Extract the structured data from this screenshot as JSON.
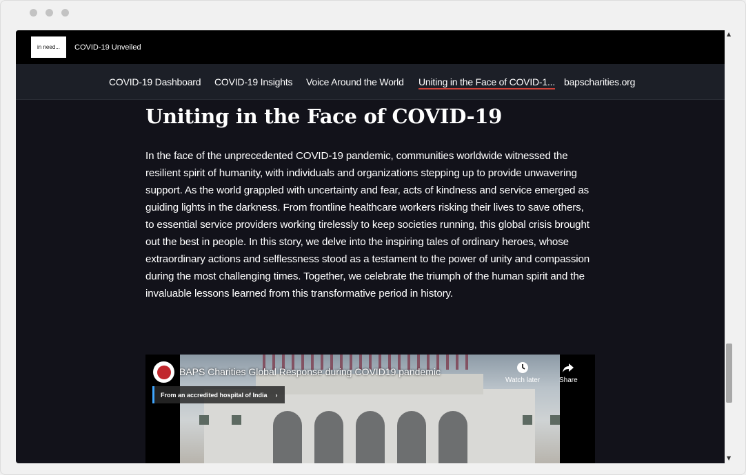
{
  "site": {
    "logo_text": "in need...",
    "title": "COVID-19 Unveiled"
  },
  "nav": {
    "items": [
      {
        "label": "COVID-19 Dashboard"
      },
      {
        "label": "COVID-19 Insights"
      },
      {
        "label": "Voice Around the World"
      },
      {
        "label": "Uniting in the Face of COVID-1..."
      },
      {
        "label": "bapscharities.org"
      }
    ],
    "active_index": 3
  },
  "article": {
    "heading": "Uniting in the Face of COVID-19",
    "body": "In the face of the unprecedented COVID-19 pandemic, communities worldwide witnessed the resilient spirit of humanity, with individuals and organizations stepping up to provide unwavering support. As the world grappled with uncertainty and fear, acts of kindness and service emerged as guiding lights in the darkness. From frontline healthcare workers risking their lives to save others, to essential service providers working tirelessly to keep societies running, this global crisis brought out the best in people. In this story, we delve into the inspiring tales of ordinary heroes, whose extraordinary actions and selflessness stood as a testament to the power of unity and compassion during the most challenging times. Together, we celebrate the triumph of the human spirit and the invaluable lessons learned from this transformative period in history."
  },
  "video": {
    "title": "BAPS Charities Global Response during COVID19 pandemic",
    "badge": "From an accredited hospital of India",
    "badge_arrow": "›",
    "watch_later": "Watch later",
    "share": "Share"
  },
  "scrollbar": {
    "up_arrow": "▲",
    "down_arrow": "▼",
    "position_fraction": 0.8
  },
  "colors": {
    "page_bg": "#12121a",
    "nav_bg": "#1c1f27",
    "active_underline": "#d0443a",
    "badge_accent": "#3ea6ff"
  }
}
